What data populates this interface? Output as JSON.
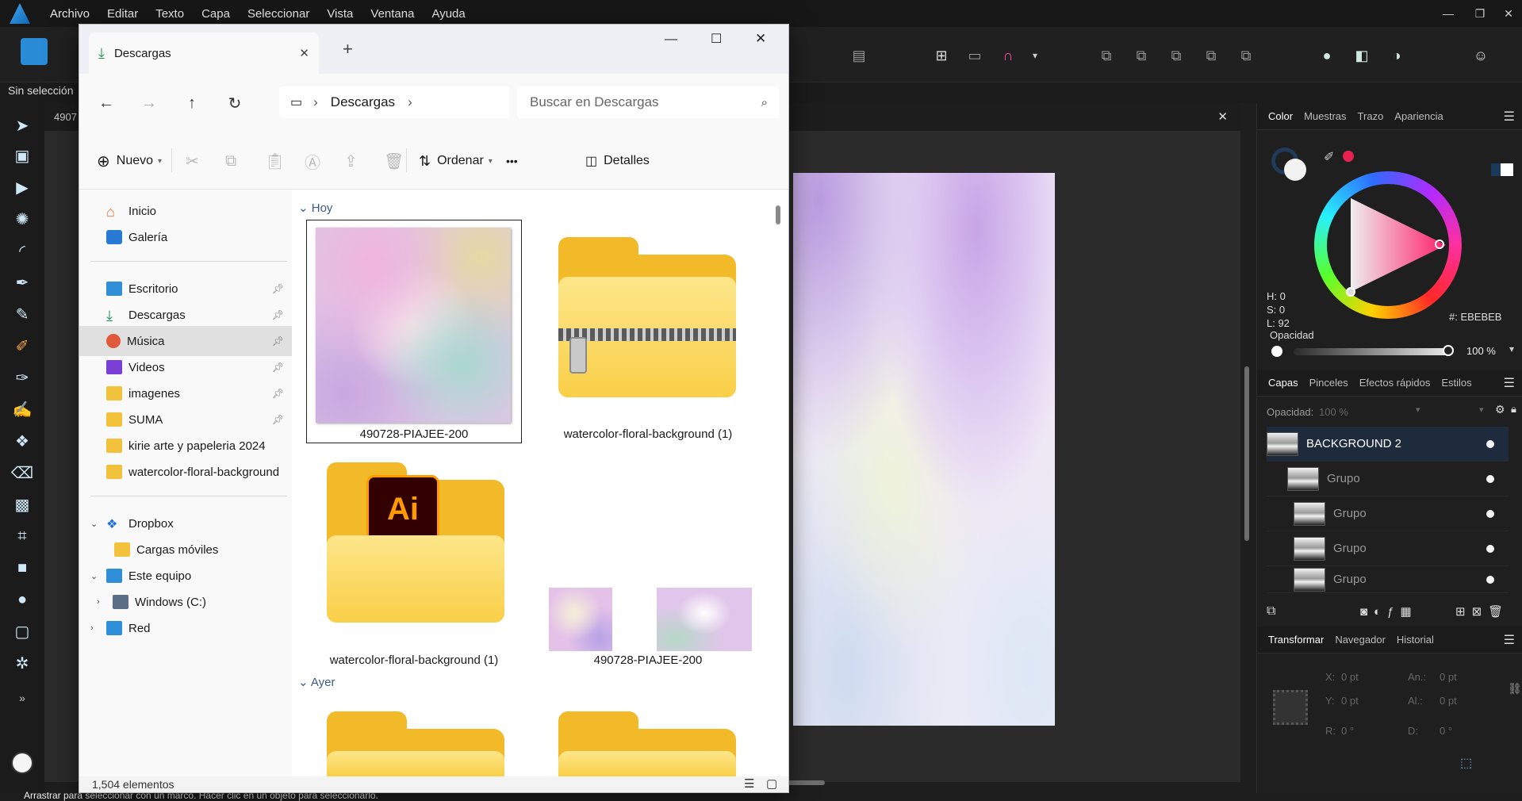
{
  "affinity": {
    "menu": [
      "Archivo",
      "Editar",
      "Texto",
      "Capa",
      "Seleccionar",
      "Vista",
      "Ventana",
      "Ayuda"
    ],
    "context_text": "Sin selección",
    "doc_tab": "4907",
    "status_hint": "Arrastrar para seleccionar con un marco. Hacer clic en un objeto para seleccionarlo.",
    "color_panel": {
      "tabs": [
        "Color",
        "Muestras",
        "Trazo",
        "Apariencia"
      ],
      "h": "H: 0",
      "s": "S: 0",
      "l": "L: 92",
      "hex": "#: EBEBEB",
      "opacity_label": "Opacidad",
      "opacity_value": "100 %"
    },
    "layers_panel": {
      "tabs": [
        "Capas",
        "Pinceles",
        "Efectos rápidos",
        "Estilos"
      ],
      "opacity_label": "Opacidad:",
      "opacity_value": "100 %",
      "layers": [
        {
          "name": "BACKGROUND 2"
        },
        {
          "name": "Grupo"
        },
        {
          "name": "Grupo"
        },
        {
          "name": "Grupo"
        },
        {
          "name": "Grupo"
        }
      ]
    },
    "transform_panel": {
      "tabs": [
        "Transformar",
        "Navegador",
        "Historial"
      ],
      "x_label": "X:",
      "x_val": "0 pt",
      "y_label": "Y:",
      "y_val": "0 pt",
      "w_label": "An.:",
      "w_val": "0 pt",
      "h_label": "Al.:",
      "h_val": "0 pt",
      "r_label": "R:",
      "r_val": "0 °",
      "d_label": "D:",
      "d_val": "0 °"
    }
  },
  "explorer": {
    "tab_title": "Descargas",
    "address": "Descargas",
    "search_placeholder": "Buscar en Descargas",
    "commands": {
      "new": "Nuevo",
      "sort": "Ordenar",
      "more": "•••",
      "details": "Detalles"
    },
    "nav": {
      "home": "Inicio",
      "gallery": "Galería",
      "quick": [
        {
          "label": "Escritorio"
        },
        {
          "label": "Descargas"
        },
        {
          "label": "Música"
        },
        {
          "label": "Videos"
        },
        {
          "label": "imagenes"
        },
        {
          "label": "SUMA"
        },
        {
          "label": "kirie arte y papeleria 2024"
        },
        {
          "label": "watercolor-floral-background"
        }
      ],
      "dropbox": "Dropbox",
      "dropbox_child": "Cargas móviles",
      "this_pc": "Este equipo",
      "drive": "Windows (C:)",
      "network": "Red"
    },
    "groups": {
      "today": "Hoy",
      "yesterday": "Ayer"
    },
    "files": [
      {
        "name": "490728-PIAJEE-200"
      },
      {
        "name": "watercolor-floral-background (1)"
      },
      {
        "name": "watercolor-floral-background (1)"
      },
      {
        "name": "490728-PIAJEE-200"
      }
    ],
    "status": "1,504 elementos"
  }
}
